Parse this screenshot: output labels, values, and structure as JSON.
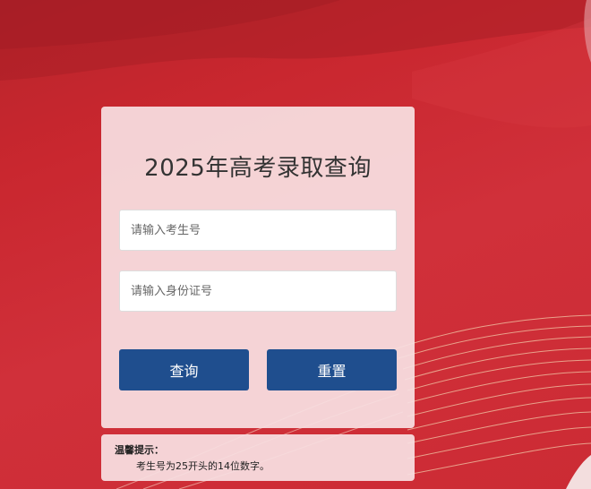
{
  "page": {
    "title": "2025年高考录取查询"
  },
  "form": {
    "exam_number_placeholder": "请输入考生号",
    "exam_number_value": "",
    "id_number_placeholder": "请输入身份证号",
    "id_number_value": ""
  },
  "buttons": {
    "query_label": "查询",
    "reset_label": "重置"
  },
  "tips": {
    "title": "温馨提示：",
    "text": "考生号为25开头的14位数字。"
  },
  "colors": {
    "background_red": "#c9272f",
    "button_blue": "#1f4e8e",
    "panel_pink": "#f7e0e2"
  }
}
